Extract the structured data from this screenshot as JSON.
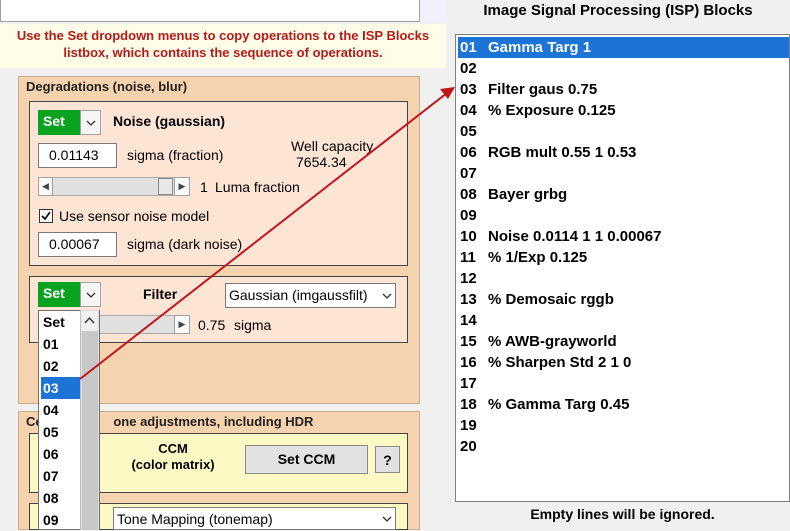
{
  "instructions": {
    "line1": "Use the Set dropdown menus to copy operations to the ISP Blocks",
    "line2": "listbox, which contains the sequence of operations."
  },
  "degradations": {
    "title": "Degradations (noise, blur)",
    "noise": {
      "set_label": "Set",
      "heading": "Noise (gaussian)",
      "sigma_value": "0.01143",
      "sigma_label": "sigma (fraction)",
      "well_capacity_label": "Well capacity",
      "well_capacity_value": "7654.34",
      "luma_value": "1",
      "luma_label": "Luma fraction",
      "luma_fraction_level": 1.0,
      "sensor_noise_label": "Use sensor noise model",
      "sensor_noise_checked": true,
      "dark_noise_value": "0.00067",
      "dark_noise_label": "sigma (dark noise)"
    },
    "filter": {
      "set_label": "Set",
      "heading": "Filter",
      "type_selected": "Gaussian (imgaussfilt)",
      "sigma_value": "0.75",
      "sigma_label": "sigma"
    }
  },
  "set_dropdown": {
    "items": [
      "Set",
      "01",
      "02",
      "03",
      "04",
      "05",
      "06",
      "07",
      "08",
      "09"
    ],
    "selected_index": 3
  },
  "ccm_section": {
    "title_visible_start": "Co",
    "title_visible_rest": "one adjustments, including HDR",
    "ccm_label_line1": "CCM",
    "ccm_label_line2": "(color matrix)",
    "set_ccm_button": "Set CCM",
    "help_button": "?",
    "tonemap_selected": "Tone Mapping (tonemap)"
  },
  "isp": {
    "title": "Image Signal Processing (ISP) Blocks",
    "rows": [
      {
        "num": "01",
        "text": "Gamma Targ 1"
      },
      {
        "num": "02",
        "text": ""
      },
      {
        "num": "03",
        "text": "Filter gaus 0.75"
      },
      {
        "num": "04",
        "text": "% Exposure 0.125"
      },
      {
        "num": "05",
        "text": ""
      },
      {
        "num": "06",
        "text": "RGB mult 0.55 1 0.53"
      },
      {
        "num": "07",
        "text": ""
      },
      {
        "num": "08",
        "text": "Bayer grbg"
      },
      {
        "num": "09",
        "text": ""
      },
      {
        "num": "10",
        "text": "Noise 0.0114 1 1 0.00067"
      },
      {
        "num": "11",
        "text": "% 1/Exp 0.125"
      },
      {
        "num": "12",
        "text": ""
      },
      {
        "num": "13",
        "text": "% Demosaic rggb"
      },
      {
        "num": "14",
        "text": ""
      },
      {
        "num": "15",
        "text": "% AWB-grayworld"
      },
      {
        "num": "16",
        "text": "% Sharpen Std 2 1 0"
      },
      {
        "num": "17",
        "text": ""
      },
      {
        "num": "18",
        "text": "% Gamma Targ 0.45"
      },
      {
        "num": "19",
        "text": ""
      },
      {
        "num": "20",
        "text": ""
      }
    ],
    "selected_index": 0,
    "footer": "Empty lines will be ignored."
  },
  "colors": {
    "set_green": "#0aa320",
    "selection_blue": "#1c74d6",
    "arrow_red": "#c0141c",
    "instruction_red": "#b31b1b"
  }
}
